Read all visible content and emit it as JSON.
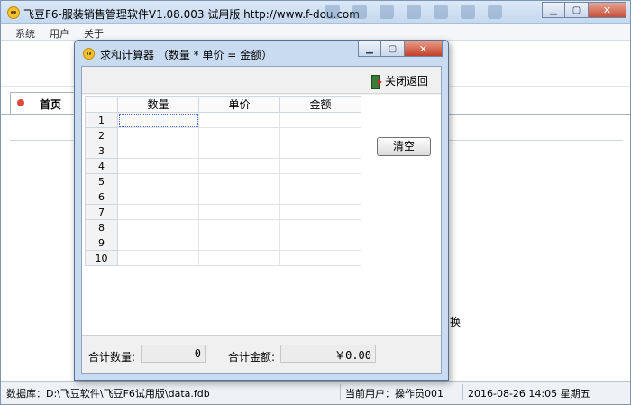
{
  "main": {
    "title": "飞豆F6-服装销售管理软件V1.08.003 试用版 http://www.f-dou.com",
    "menu": [
      "系统",
      "用户",
      "关于"
    ],
    "home_tab": "首页",
    "partial_text": "换"
  },
  "status": {
    "database": "数据库：D:\\飞豆软件\\飞豆F6试用版\\data.fdb",
    "user": "当前用户：操作员001",
    "datetime": "2016-08-26 14:05 星期五"
  },
  "dialog": {
    "title": "求和计算器 （数量 * 单价 = 金额）",
    "close_return": "关闭返回",
    "clear_label": "清空",
    "columns": [
      "数量",
      "单价",
      "金额"
    ],
    "rows": [
      "1",
      "2",
      "3",
      "4",
      "5",
      "6",
      "7",
      "8",
      "9",
      "10"
    ],
    "total_qty_label": "合计数量:",
    "total_qty_value": "0",
    "total_amount_label": "合计金额:",
    "total_amount_value": "￥0.00"
  },
  "colors": {
    "accent": "#c9dbf0",
    "close_button": "#c7503a"
  },
  "icons": [
    "app-icon",
    "minimize-icon",
    "maximize-icon",
    "close-icon",
    "exit-door-icon"
  ]
}
